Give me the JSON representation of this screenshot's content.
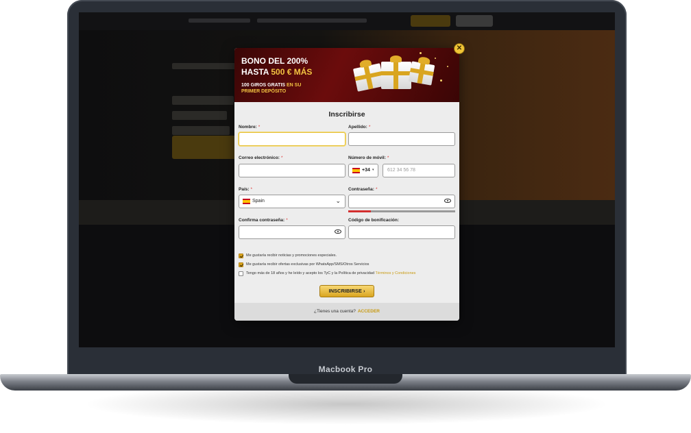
{
  "device": {
    "label": "Macbook Pro"
  },
  "promo": {
    "line1": "BONO DEL 200%",
    "line2_prefix": "HASTA ",
    "line2_amount": "500 € MÁS",
    "line3_prefix": "100 GIROS GRATIS ",
    "line3_highlight": "EN SU",
    "line4": "PRIMER DEPÓSITO"
  },
  "form": {
    "title": "Inscribirse",
    "required_mark": "*",
    "nombre_label": "Nombre:",
    "apellido_label": "Apellido:",
    "email_label": "Correo electrónico:",
    "mobile_label": "Número de móvil:",
    "country_code": "+34",
    "phone_placeholder": "612 34 56 78",
    "country_label": "País:",
    "country_value": "Spain",
    "password_label": "Contraseña:",
    "password_strength": 0.21,
    "confirm_label": "Confirma contraseña:",
    "bonus_label": "Código de bonificación:",
    "check1": "Me gustaría recibir noticias y promociones especiales.",
    "check2": "Me gustaría recibir ofertas exclusivas por WhatsApp/SMS/Otros Servicios",
    "check3_text": "Tengo más de 18 años y he leído y acepto los TyC y la Política de privacidad ",
    "check3_link": "Términos y Condiciones",
    "submit": "INSCRIBIRSE",
    "submit_arrow": "›",
    "have_account": "¿Tienes una cuenta?",
    "login": "ACCEDER"
  },
  "colors": {
    "accent_gold": "#d9a520",
    "link_gold": "#c89a10",
    "banner_red": "#6b0c0c",
    "error_red": "#d32f2f"
  },
  "icons": {
    "close": "close-icon",
    "eye": "eye-icon",
    "flag": "spain-flag-icon",
    "chevron": "chevron-down-icon",
    "check": "check-icon"
  }
}
